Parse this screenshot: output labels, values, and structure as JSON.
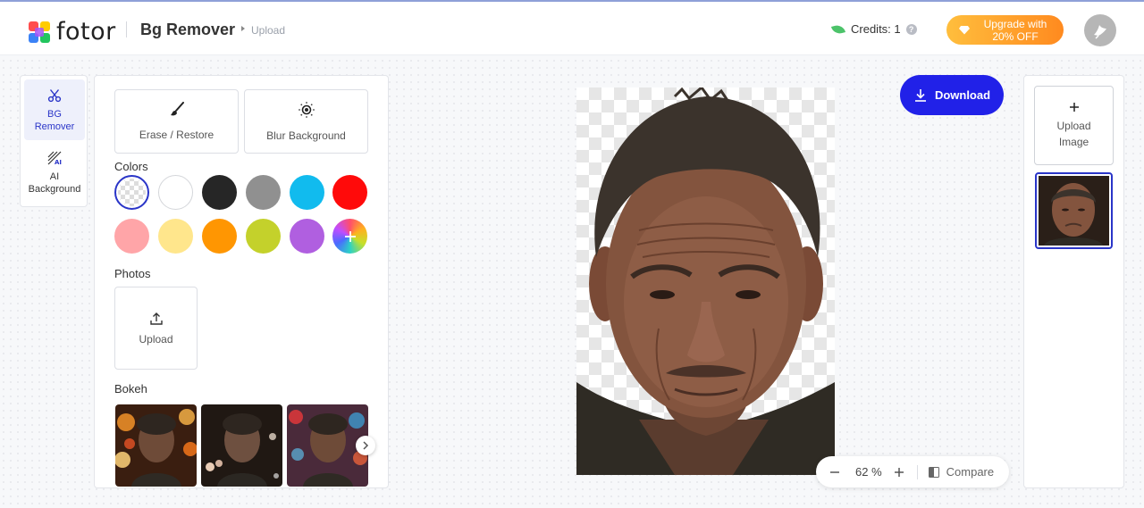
{
  "header": {
    "logo_text": "fotor",
    "app_title": "Bg Remover",
    "breadcrumb": "Upload",
    "credits_label": "Credits: 1",
    "help_glyph": "?",
    "upgrade_line1": "Upgrade with",
    "upgrade_line2": "20% OFF"
  },
  "rail": {
    "items": [
      {
        "label_line1": "BG",
        "label_line2": "Remover",
        "icon": "scissors-icon",
        "active": true
      },
      {
        "label_line1": "AI",
        "label_line2": "Background",
        "icon": "ai-background-icon",
        "active": false
      }
    ]
  },
  "panel": {
    "tools": [
      "Erase / Restore",
      "Blur Background"
    ],
    "colors_title": "Colors",
    "colors": [
      "transparent",
      "#ffffff",
      "#262626",
      "#909090",
      "#11bbee",
      "#ff0a0a",
      "#ffa5a8",
      "#ffe68c",
      "#ff9602",
      "#c4d12b",
      "#b05fe0",
      "gradient-add"
    ],
    "photos_title": "Photos",
    "photo_upload_label": "Upload",
    "bokeh_title": "Bokeh"
  },
  "canvas": {
    "download_label": "Download",
    "zoom_value": "62 %",
    "compare_label": "Compare"
  },
  "right_panel": {
    "upload_line1": "Upload",
    "upload_line2": "Image"
  },
  "theme": {
    "accent": "#2121e8",
    "active_text": "#2a35c8",
    "upgrade_gradient": [
      "#ffbe3d",
      "#ff8a1f"
    ]
  }
}
